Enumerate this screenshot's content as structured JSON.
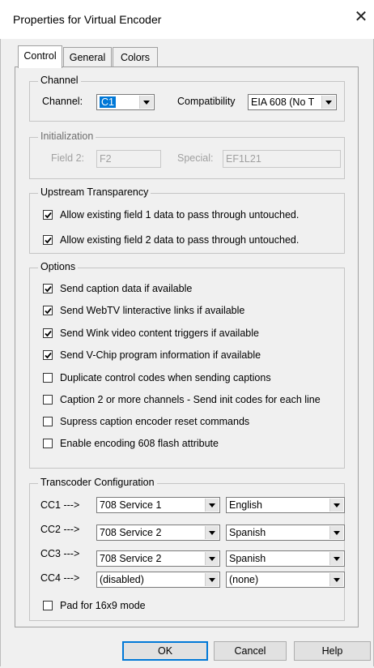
{
  "window": {
    "title": "Properties for Virtual Encoder",
    "close_glyph": "✕"
  },
  "tabs": [
    {
      "label": "Control",
      "active": true
    },
    {
      "label": "General",
      "active": false
    },
    {
      "label": "Colors",
      "active": false
    }
  ],
  "channel_group": {
    "title": "Channel",
    "channel_label": "Channel:",
    "channel_value": "C1",
    "compat_label": "Compatibility",
    "compat_value": "EIA 608 (No T"
  },
  "init_group": {
    "title": "Initialization",
    "field2_label": "Field 2:",
    "field2_value": "F2",
    "special_label": "Special:",
    "special_value": "EF1L21"
  },
  "upstream_group": {
    "title": "Upstream Transparency",
    "items": [
      {
        "label": "Allow existing field 1 data to pass through untouched.",
        "checked": true
      },
      {
        "label": "Allow existing field 2 data to pass through untouched.",
        "checked": true
      }
    ]
  },
  "options_group": {
    "title": "Options",
    "items": [
      {
        "label": "Send caption data if available",
        "checked": true
      },
      {
        "label": "Send WebTV linteractive links if available",
        "checked": true
      },
      {
        "label": "Send Wink video content triggers if available",
        "checked": true
      },
      {
        "label": "Send V-Chip program information if available",
        "checked": true
      },
      {
        "label": "Duplicate control codes when sending captions",
        "checked": false
      },
      {
        "label": "Caption 2 or more channels - Send init codes for each line",
        "checked": false
      },
      {
        "label": "Supress caption encoder reset commands",
        "checked": false
      },
      {
        "label": "Enable encoding 608 flash attribute",
        "checked": false
      }
    ]
  },
  "transcoder_group": {
    "title": "Transcoder Configuration",
    "rows": [
      {
        "label": "CC1 --->",
        "service": "708 Service 1",
        "language": "English"
      },
      {
        "label": "CC2 --->",
        "service": "708 Service 2",
        "language": "Spanish"
      },
      {
        "label": "CC3 --->",
        "service": "708 Service 2",
        "language": "Spanish"
      },
      {
        "label": "CC4 --->",
        "service": "(disabled)",
        "language": "(none)"
      }
    ],
    "pad_label": "Pad for 16x9 mode",
    "pad_checked": false
  },
  "buttons": {
    "ok": "OK",
    "cancel": "Cancel",
    "help": "Help"
  },
  "colors": {
    "accent": "#0078d7",
    "disabled_text": "#a0a0a0",
    "face": "#f0f0f0"
  },
  "icons": {
    "close": "close-icon",
    "dropdown": "chevron-down-icon",
    "check": "check-icon"
  }
}
